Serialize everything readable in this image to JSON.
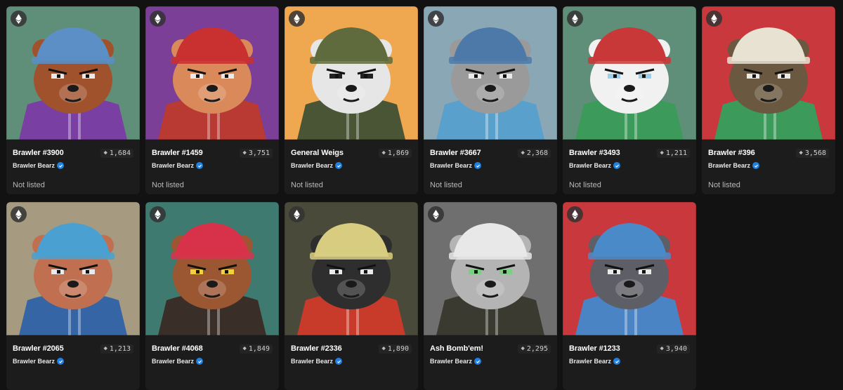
{
  "collection": "Brawler Bearz",
  "currency_icon": "eth-icon",
  "items": [
    {
      "name": "Brawler #3900",
      "price": "1,684",
      "status": "Not listed",
      "bg": "#5f8f78",
      "body": "#a0522d",
      "hat": "#5b8fc6",
      "clothes": "#7a3fa3",
      "eye": "#eaeaea"
    },
    {
      "name": "Brawler #1459",
      "price": "3,751",
      "status": "Not listed",
      "bg": "#7b3f98",
      "body": "#d9895a",
      "hat": "#c93030",
      "clothes": "#b83a32",
      "eye": "#eaeaea"
    },
    {
      "name": "General Weigs",
      "price": "1,869",
      "status": "Not listed",
      "bg": "#f0a850",
      "body": "#e6e6e6",
      "hat": "#5f6b3c",
      "clothes": "#4a5535",
      "eye": "#222222"
    },
    {
      "name": "Brawler #3667",
      "price": "2,368",
      "status": "Not listed",
      "bg": "#8aa7b5",
      "body": "#9a9a9a",
      "hat": "#4d79a8",
      "clothes": "#5aa0cc",
      "eye": "#eaeaea"
    },
    {
      "name": "Brawler #3493",
      "price": "1,211",
      "status": "Not listed",
      "bg": "#5f8f78",
      "body": "#f1f1f1",
      "hat": "#c83838",
      "clothes": "#3c9a5a",
      "eye": "#9ad0ee"
    },
    {
      "name": "Brawler #396",
      "price": "3,568",
      "status": "Not listed",
      "bg": "#c8383c",
      "body": "#6b5840",
      "hat": "#e8e2d2",
      "clothes": "#3c9a5a",
      "eye": "#eaeaea"
    },
    {
      "name": "Brawler #2065",
      "price": "1,213",
      "status": "",
      "bg": "#a69a80",
      "body": "#c07050",
      "hat": "#4aa0d0",
      "clothes": "#3565a5",
      "eye": "#eaeaea"
    },
    {
      "name": "Brawler #4068",
      "price": "1,849",
      "status": "",
      "bg": "#3e7a70",
      "body": "#9b5632",
      "hat": "#d8324a",
      "clothes": "#3a2e28",
      "eye": "#f2d040"
    },
    {
      "name": "Brawler #2336",
      "price": "1,890",
      "status": "",
      "bg": "#4a4a3a",
      "body": "#2e2e2e",
      "hat": "#d8cc80",
      "clothes": "#c83a2a",
      "eye": "#eaeaea"
    },
    {
      "name": "Ash Bomb'em!",
      "price": "2,295",
      "status": "",
      "bg": "#6f6f6f",
      "body": "#b4b4b4",
      "hat": "#e8e8e8",
      "clothes": "#3a3a30",
      "eye": "#7ad080"
    },
    {
      "name": "Brawler #1233",
      "price": "3,940",
      "status": "",
      "bg": "#c8383c",
      "body": "#5e5e66",
      "hat": "#4a8ac8",
      "clothes": "#4a84c4",
      "eye": "#eaeaea"
    }
  ]
}
